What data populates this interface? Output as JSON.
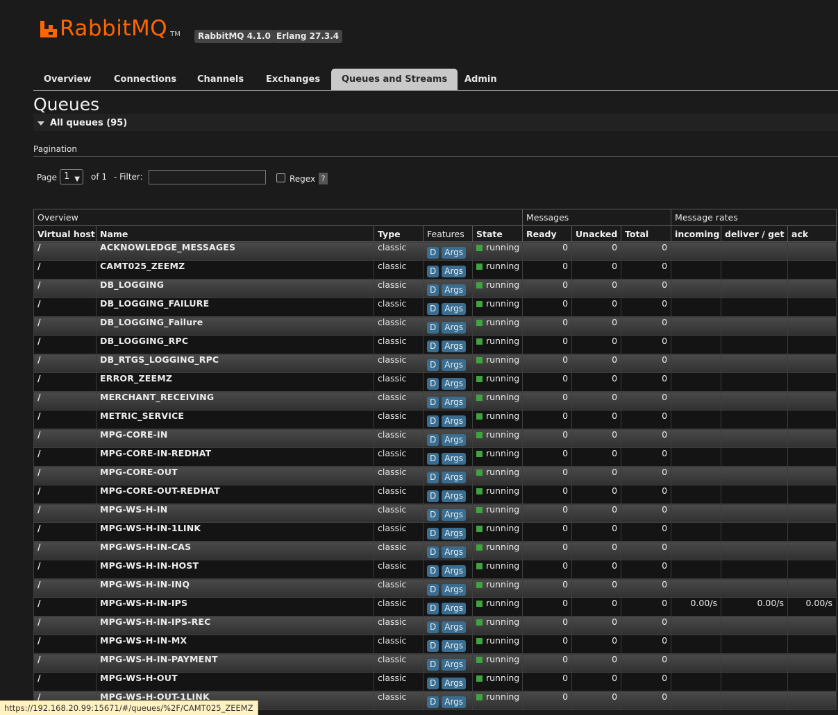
{
  "header": {
    "brand": "RabbitMQ",
    "tm": "TM",
    "badges": [
      "RabbitMQ 4.1.0",
      "Erlang 27.3.4"
    ],
    "brand_color": "#ff6600"
  },
  "tabs": [
    {
      "label": "Overview"
    },
    {
      "label": "Connections"
    },
    {
      "label": "Channels"
    },
    {
      "label": "Exchanges"
    },
    {
      "label": "Queues and Streams",
      "active": true
    },
    {
      "label": "Admin"
    }
  ],
  "page_title": "Queues",
  "section_toggle": "All queues (95)",
  "pagination": {
    "label": "Pagination",
    "page_label": "Page",
    "page_value": "1",
    "of_label": "of 1",
    "filter_label": "- Filter:",
    "filter_value": "",
    "regex_label": "Regex",
    "help": "?"
  },
  "table": {
    "groups": [
      "Overview",
      "Messages",
      "Message rates"
    ],
    "columns": [
      "Virtual host",
      "Name",
      "Type",
      "Features",
      "State",
      "Ready",
      "Unacked",
      "Total",
      "incoming",
      "deliver / get",
      "ack"
    ],
    "feature_badges": [
      "D",
      "Args"
    ],
    "rows": [
      {
        "vhost": "/",
        "name": "ACKNOWLEDGE_MESSAGES",
        "type": "classic",
        "state": "running",
        "ready": "0",
        "unacked": "0",
        "total": "0",
        "incoming": "",
        "deliver": "",
        "ack": ""
      },
      {
        "vhost": "/",
        "name": "CAMT025_ZEEMZ",
        "type": "classic",
        "state": "running",
        "ready": "0",
        "unacked": "0",
        "total": "0",
        "incoming": "",
        "deliver": "",
        "ack": ""
      },
      {
        "vhost": "/",
        "name": "DB_LOGGING",
        "type": "classic",
        "state": "running",
        "ready": "0",
        "unacked": "0",
        "total": "0",
        "incoming": "",
        "deliver": "",
        "ack": ""
      },
      {
        "vhost": "/",
        "name": "DB_LOGGING_FAILURE",
        "type": "classic",
        "state": "running",
        "ready": "0",
        "unacked": "0",
        "total": "0",
        "incoming": "",
        "deliver": "",
        "ack": ""
      },
      {
        "vhost": "/",
        "name": "DB_LOGGING_Failure",
        "type": "classic",
        "state": "running",
        "ready": "0",
        "unacked": "0",
        "total": "0",
        "incoming": "",
        "deliver": "",
        "ack": ""
      },
      {
        "vhost": "/",
        "name": "DB_LOGGING_RPC",
        "type": "classic",
        "state": "running",
        "ready": "0",
        "unacked": "0",
        "total": "0",
        "incoming": "",
        "deliver": "",
        "ack": ""
      },
      {
        "vhost": "/",
        "name": "DB_RTGS_LOGGING_RPC",
        "type": "classic",
        "state": "running",
        "ready": "0",
        "unacked": "0",
        "total": "0",
        "incoming": "",
        "deliver": "",
        "ack": ""
      },
      {
        "vhost": "/",
        "name": "ERROR_ZEEMZ",
        "type": "classic",
        "state": "running",
        "ready": "0",
        "unacked": "0",
        "total": "0",
        "incoming": "",
        "deliver": "",
        "ack": ""
      },
      {
        "vhost": "/",
        "name": "MERCHANT_RECEIVING",
        "type": "classic",
        "state": "running",
        "ready": "0",
        "unacked": "0",
        "total": "0",
        "incoming": "",
        "deliver": "",
        "ack": ""
      },
      {
        "vhost": "/",
        "name": "METRIC_SERVICE",
        "type": "classic",
        "state": "running",
        "ready": "0",
        "unacked": "0",
        "total": "0",
        "incoming": "",
        "deliver": "",
        "ack": ""
      },
      {
        "vhost": "/",
        "name": "MPG-CORE-IN",
        "type": "classic",
        "state": "running",
        "ready": "0",
        "unacked": "0",
        "total": "0",
        "incoming": "",
        "deliver": "",
        "ack": ""
      },
      {
        "vhost": "/",
        "name": "MPG-CORE-IN-REDHAT",
        "type": "classic",
        "state": "running",
        "ready": "0",
        "unacked": "0",
        "total": "0",
        "incoming": "",
        "deliver": "",
        "ack": ""
      },
      {
        "vhost": "/",
        "name": "MPG-CORE-OUT",
        "type": "classic",
        "state": "running",
        "ready": "0",
        "unacked": "0",
        "total": "0",
        "incoming": "",
        "deliver": "",
        "ack": ""
      },
      {
        "vhost": "/",
        "name": "MPG-CORE-OUT-REDHAT",
        "type": "classic",
        "state": "running",
        "ready": "0",
        "unacked": "0",
        "total": "0",
        "incoming": "",
        "deliver": "",
        "ack": ""
      },
      {
        "vhost": "/",
        "name": "MPG-WS-H-IN",
        "type": "classic",
        "state": "running",
        "ready": "0",
        "unacked": "0",
        "total": "0",
        "incoming": "",
        "deliver": "",
        "ack": ""
      },
      {
        "vhost": "/",
        "name": "MPG-WS-H-IN-1LINK",
        "type": "classic",
        "state": "running",
        "ready": "0",
        "unacked": "0",
        "total": "0",
        "incoming": "",
        "deliver": "",
        "ack": ""
      },
      {
        "vhost": "/",
        "name": "MPG-WS-H-IN-CAS",
        "type": "classic",
        "state": "running",
        "ready": "0",
        "unacked": "0",
        "total": "0",
        "incoming": "",
        "deliver": "",
        "ack": ""
      },
      {
        "vhost": "/",
        "name": "MPG-WS-H-IN-HOST",
        "type": "classic",
        "state": "running",
        "ready": "0",
        "unacked": "0",
        "total": "0",
        "incoming": "",
        "deliver": "",
        "ack": ""
      },
      {
        "vhost": "/",
        "name": "MPG-WS-H-IN-INQ",
        "type": "classic",
        "state": "running",
        "ready": "0",
        "unacked": "0",
        "total": "0",
        "incoming": "",
        "deliver": "",
        "ack": ""
      },
      {
        "vhost": "/",
        "name": "MPG-WS-H-IN-IPS",
        "type": "classic",
        "state": "running",
        "ready": "0",
        "unacked": "0",
        "total": "0",
        "incoming": "0.00/s",
        "deliver": "0.00/s",
        "ack": "0.00/s"
      },
      {
        "vhost": "/",
        "name": "MPG-WS-H-IN-IPS-REC",
        "type": "classic",
        "state": "running",
        "ready": "0",
        "unacked": "0",
        "total": "0",
        "incoming": "",
        "deliver": "",
        "ack": ""
      },
      {
        "vhost": "/",
        "name": "MPG-WS-H-IN-MX",
        "type": "classic",
        "state": "running",
        "ready": "0",
        "unacked": "0",
        "total": "0",
        "incoming": "",
        "deliver": "",
        "ack": ""
      },
      {
        "vhost": "/",
        "name": "MPG-WS-H-IN-PAYMENT",
        "type": "classic",
        "state": "running",
        "ready": "0",
        "unacked": "0",
        "total": "0",
        "incoming": "",
        "deliver": "",
        "ack": ""
      },
      {
        "vhost": "/",
        "name": "MPG-WS-H-OUT",
        "type": "classic",
        "state": "running",
        "ready": "0",
        "unacked": "0",
        "total": "0",
        "incoming": "",
        "deliver": "",
        "ack": ""
      },
      {
        "vhost": "/",
        "name": "MPG-WS-H-OUT-1LINK",
        "type": "classic",
        "state": "running",
        "ready": "0",
        "unacked": "0",
        "total": "0",
        "incoming": "",
        "deliver": "",
        "ack": ""
      }
    ]
  },
  "status_bar": "https://192.168.20.99:15671/#/queues/%2F/CAMT025_ZEEMZ"
}
